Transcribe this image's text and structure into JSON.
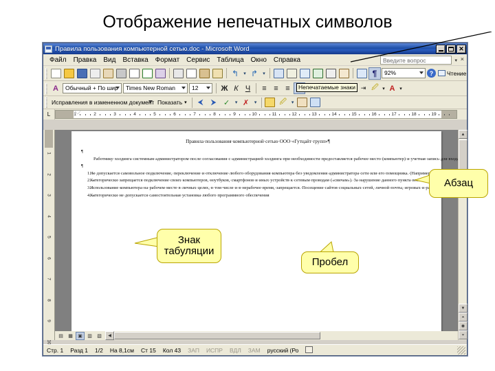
{
  "slide": {
    "title": "Отображение непечатных символов"
  },
  "window": {
    "title": "Правила пользования компьютерной сетью.doc - Microsoft Word",
    "icon": "word-document-icon",
    "buttons": {
      "minimize": "minimize-icon",
      "maximize": "maximize-icon",
      "close": "close-icon"
    }
  },
  "menubar": {
    "items": [
      "Файл",
      "Правка",
      "Вид",
      "Вставка",
      "Формат",
      "Сервис",
      "Таблица",
      "Окно",
      "Справка"
    ],
    "ask_placeholder": "Введите вопрос",
    "ask_value": "",
    "close_label": "×"
  },
  "standard_toolbar": {
    "zoom_value": "92%",
    "reading_label": "Чтение",
    "show_marks_active": true,
    "icons": [
      "new-document-icon",
      "open-folder-icon",
      "save-icon",
      "mail-icon",
      "permission-icon",
      "print-icon",
      "print-preview-icon",
      "spelling-check-icon",
      "research-icon",
      "cut-icon",
      "copy-icon",
      "paste-icon",
      "format-painter-icon",
      "undo-icon",
      "undo-dropdown-icon",
      "redo-icon",
      "redo-dropdown-icon",
      "insert-hyperlink-icon",
      "tables-borders-icon",
      "insert-table-icon",
      "insert-excel-table-icon",
      "columns-icon",
      "drawing-icon",
      "document-map-icon",
      "show-formatting-marks-icon",
      "help-icon",
      "reading-layout-icon"
    ]
  },
  "formatting_toolbar": {
    "style_value": "Обычный + По шир",
    "font_value": "Times New Roman",
    "size_value": "12",
    "bold_label": "Ж",
    "italic_label": "К",
    "underline_label": "Ч",
    "align_left": "align-left-icon",
    "align_center": "align-center-icon",
    "align_right": "align-right-icon",
    "align_justify": "align-justify-icon",
    "line_spacing": "line-spacing-icon",
    "numbering": "numbering-icon",
    "bullets": "bullets-icon",
    "decrease_indent": "decrease-indent-icon",
    "increase_indent": "increase-indent-icon",
    "highlight": "highlight-color-icon",
    "font_color": "font-color-icon",
    "tooltip": "Непечатаемые знаки"
  },
  "reviewing_toolbar": {
    "display_value": "Исправления в измененном документе",
    "show_label": "Показать",
    "icons": [
      "previous-change-icon",
      "next-change-icon",
      "accept-change-icon",
      "reject-change-icon",
      "new-comment-icon",
      "highlight-icon",
      "track-changes-icon",
      "reviewing-pane-icon"
    ]
  },
  "ruler": {
    "tab_stop_label": "L",
    "horizontal_ticks": [
      "1",
      "2",
      "3",
      "4",
      "5",
      "6",
      "7",
      "8",
      "9",
      "10",
      "11",
      "12",
      "13",
      "14",
      "15",
      "16",
      "17",
      "18",
      "19"
    ],
    "vertical_ticks": [
      "1",
      "2",
      "3",
      "4",
      "5",
      "6",
      "7",
      "8",
      "9",
      "10"
    ]
  },
  "document": {
    "heading": "Правила·пользования·компьютерной·сетью·ООО·«Гутцайт·групп»¶",
    "pilcrow": "¶",
    "paragraphs": [
      "Работнику·холдинга·системным·администратором·после·согласования·с·администрацией·холдинга·при·необходимости·предоставляется·рабочее·место·(компьютер)·и·учетная·запись·для·входа·в·сеть.·При·работе·на·персональном·компьютере·в·сети·холдинга·необходимо·выполнять·следующие·правила:¶"
    ],
    "list_items": [
      {
        "num": "1.",
        "tab": "→",
        "text": "Не·допускается·самовольное·подключение,·переключение·и·отключение·любого·оборудования·компьютера·без·уведомления·администратора·сети·или·его·помощника.·(Например,·подключение·своих·наушников,·телефонов,·мыши;·отключение·принтеров,·мониторов,·колонок·и·т.п.)¶"
      },
      {
        "num": "2.",
        "tab": "→",
        "text": "Категорически·запрещается·подключение·своих·компьютеров,·ноутбуков,·смартфонов·и·иных·устройств·к·сетевым·проводам·(«свичам»).·За·нарушение·данного·пункта·возможны·серьезные·штрафные·санкции,·вплоть·до·увольнения.·Также·запрещается·самостоятельно·переключать·любые·сетевые·провода·в·коммутаторах.¶"
      },
      {
        "num": "3.",
        "tab": "→",
        "text": "Использование·компьютера·на·рабочем·месте·в·личных·целях,·в·том·числе·и·в·нерабочее·время,·запрещается.·Посещение·сайтов·социальных·сетей,·личной·почты,·игровых·и·развлекательных·порталов,·как·правило,·не·разрешается,·за·исключением·тех,·кому·это·необходимо·для·работы·(например,·размещение·рекламы).·Категорически·запрещается·скачивать·большие·объемы·информации·(например,·фильмы)·из·Интернета·без·согласования·с·системным·администратором.¶"
      },
      {
        "num": "4.",
        "tab": "→",
        "text": "Категорически·не·допускается·самостоятельная·установка·любого·программного·обеспечения"
      }
    ]
  },
  "callouts": [
    {
      "id": "abzac",
      "label": "Абзац"
    },
    {
      "id": "tab",
      "label": "Знак табуляции"
    },
    {
      "id": "space",
      "label": "Пробел"
    }
  ],
  "statusbar": {
    "page": "Стр. 1",
    "section": "Разд 1",
    "pages": "1/2",
    "position": "На 8,1см",
    "line": "Ст 15",
    "column": "Кол 43",
    "rec": "ЗАП",
    "trk": "ИСПР",
    "ext": "ВДЛ",
    "ovr": "ЗАМ",
    "language": "русский (Ро",
    "spell_icon": "spelling-status-icon"
  },
  "view_buttons": [
    "normal-view-icon",
    "web-layout-icon",
    "print-layout-icon",
    "outline-view-icon",
    "reading-view-icon"
  ]
}
